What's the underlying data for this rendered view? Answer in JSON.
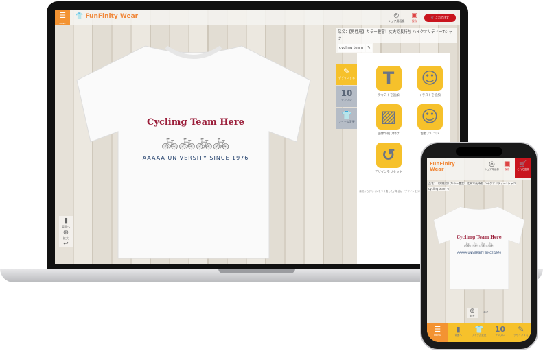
{
  "app": {
    "logo": "FunFinity Wear",
    "menu_label": "MENU",
    "share_label": "シェア用画像",
    "save_label": "保存",
    "cart_label": "これで注文"
  },
  "product": {
    "name": "品名：【男性用】カラー豊富！丈夫で長持ち ハイクオリティーTシャツ",
    "design_name": "cycling team"
  },
  "side_tabs": [
    {
      "label": "デザインする",
      "icon": "pencil-icon"
    },
    {
      "label": "テンプレ",
      "icon": "template-10-icon",
      "glyph": "10"
    },
    {
      "label": "アイテム変更",
      "icon": "tshirt-icon"
    }
  ],
  "tools": [
    {
      "label": "テキストを追加",
      "icon": "text-icon",
      "glyph": "T"
    },
    {
      "label": "イラストを追加",
      "icon": "smiley-icon",
      "glyph": "☺"
    },
    {
      "label": "画像の貼り付け",
      "icon": "image-icon",
      "glyph": "▨"
    },
    {
      "label": "古着アレンジ",
      "icon": "smiley-icon",
      "glyph": "☺"
    },
    {
      "label": "デザインをリセット",
      "icon": "reset-icon",
      "glyph": "↺"
    }
  ],
  "note": "最初からデザインをやり直したい場合は「デザインをリセット」をご利用ください",
  "canvas_tools": {
    "back_label": "背面へ",
    "zoom_label": "拡大"
  },
  "design": {
    "line1": "Cyclimg  Team  Here",
    "bikes": "🚲🚲🚲🚲",
    "line3": "AAAAA UNIVERSITY SINCE 1976"
  },
  "phone_bar": [
    {
      "label": "MENU",
      "glyph": "☰"
    },
    {
      "label": "背面へ",
      "glyph": "▮"
    },
    {
      "label": "アイテム変更",
      "glyph": "👕"
    },
    {
      "label": "テンプレ",
      "glyph": "10"
    },
    {
      "label": "デザインする",
      "glyph": "✎"
    }
  ],
  "colors": {
    "accent": "#f39332",
    "tool_yellow": "#f6c12b",
    "cart_red": "#c9151e",
    "design_red": "#9b1e3a",
    "design_navy": "#213f6b"
  }
}
